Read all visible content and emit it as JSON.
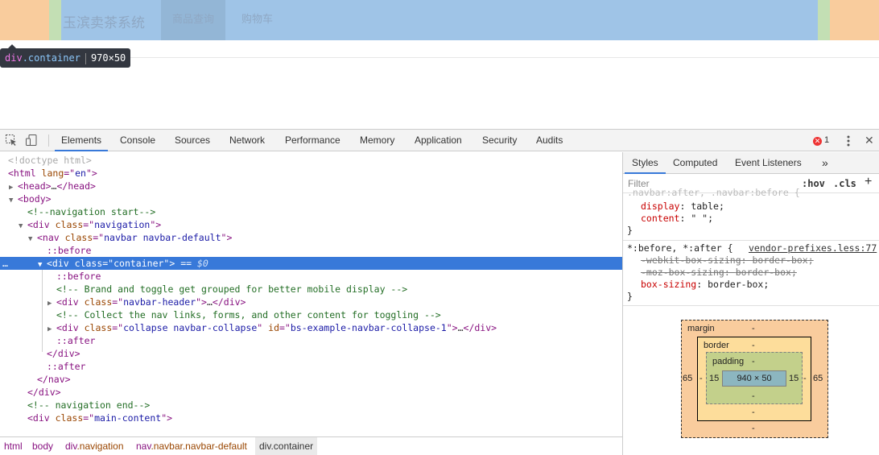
{
  "preview": {
    "brand": "玉滨卖茶系统",
    "nav_items": [
      "商品查询",
      "购物车"
    ],
    "tooltip": {
      "tag": "div",
      "class": ".container",
      "size": "970×50"
    }
  },
  "toolbar": {
    "tabs": [
      "Elements",
      "Console",
      "Sources",
      "Network",
      "Performance",
      "Memory",
      "Application",
      "Security",
      "Audits"
    ],
    "active_tab": "Elements",
    "error_count": "1"
  },
  "elements": {
    "doctype": "<!doctype html>",
    "html_open": [
      "<html ",
      "lang",
      "=\"",
      "en",
      "\">"
    ],
    "head": [
      "<head>",
      "…",
      "</head>"
    ],
    "body": "<body>",
    "comment_nav_start": "<!--navigation start-->",
    "div_navigation": [
      "<div ",
      "class",
      "=\"",
      "navigation",
      "\">"
    ],
    "nav_open": [
      "<nav ",
      "class",
      "=\"",
      "navbar navbar-default",
      "\">"
    ],
    "before": "::before",
    "selected_div": [
      "<div ",
      "class",
      "=\"",
      "container",
      "\">",
      " == ",
      "$0"
    ],
    "comment_brand": "<!-- Brand and toggle get grouped for better mobile display -->",
    "navbar_header": [
      "<div ",
      "class",
      "=\"",
      "navbar-header",
      "\">",
      "…",
      "</div>"
    ],
    "comment_collect": "<!-- Collect the nav links, forms, and other content for toggling -->",
    "collapse": [
      "<div ",
      "class",
      "=\"",
      "collapse navbar-collapse",
      "\" ",
      "id",
      "=\"",
      "bs-example-navbar-collapse-1",
      "\">",
      "…",
      "</div>"
    ],
    "after": "::after",
    "close_div": "</div>",
    "close_nav": "</nav>",
    "comment_nav_end": "<!-- navigation end-->",
    "main_content": [
      "<div ",
      "class",
      "=\"",
      "main-content",
      "\">"
    ]
  },
  "breadcrumbs": [
    {
      "tag": "html",
      "cls": ""
    },
    {
      "tag": "body",
      "cls": ""
    },
    {
      "tag": "div",
      "cls": ".navigation"
    },
    {
      "tag": "nav",
      "cls": ".navbar.navbar-default"
    },
    {
      "tag": "div",
      "cls": ".container"
    }
  ],
  "styles": {
    "tabs": [
      "Styles",
      "Computed",
      "Event Listeners"
    ],
    "more": "»",
    "filter_placeholder": "Filter",
    "hov": ":hov",
    "cls": ".cls",
    "add": "+",
    "rule1": [
      {
        "prop": "display",
        "value": "table"
      },
      {
        "prop": "content",
        "value": "\" \""
      }
    ],
    "rule2_selector": "*:before, *:after {",
    "rule2_source": "vendor-prefixes.less:77",
    "rule2": [
      {
        "prop": "-webkit-box-sizing",
        "value": "border-box",
        "struck": true
      },
      {
        "prop": "-moz-box-sizing",
        "value": "border-box",
        "struck": true
      },
      {
        "prop": "box-sizing",
        "value": "border-box",
        "struck": false
      }
    ],
    "close_brace": "}"
  },
  "box_model": {
    "margin_label": "margin",
    "border_label": "border",
    "padding_label": "padding",
    "margin": {
      "top": "-",
      "right": "65",
      "bottom": "-",
      "left": "65"
    },
    "border": {
      "top": "-",
      "right": "-",
      "bottom": "-",
      "left": "-"
    },
    "padding": {
      "top": "-",
      "right": "15",
      "bottom": "-",
      "left": "15"
    },
    "content": "940 × 50"
  },
  "colors": {
    "margin": "#f9cc9d",
    "padding": "#c3dfb4",
    "content": "#9fc4e7",
    "selection": "#3879d9"
  }
}
